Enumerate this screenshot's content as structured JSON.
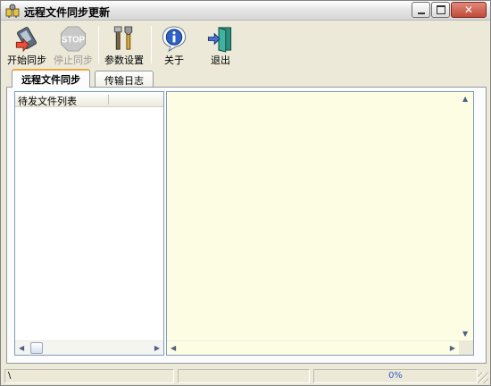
{
  "window": {
    "title": "远程文件同步更新"
  },
  "toolbar": {
    "buttons": [
      {
        "label": "开始同步",
        "icon": "sync-start-icon",
        "enabled": true
      },
      {
        "label": "停止同步",
        "icon": "stop-sign-icon",
        "enabled": false,
        "icon_text": "STOP"
      },
      {
        "label": "参数设置",
        "icon": "settings-tools-icon",
        "enabled": true
      },
      {
        "label": "关于",
        "icon": "info-icon",
        "enabled": true
      },
      {
        "label": "退出",
        "icon": "exit-door-icon",
        "enabled": true
      }
    ]
  },
  "tabs": [
    {
      "label": "远程文件同步",
      "active": true
    },
    {
      "label": "传输日志",
      "active": false
    }
  ],
  "file_list": {
    "header": "待发文件列表"
  },
  "statusbar": {
    "panel1": "\\",
    "panel2": "",
    "progress": "0%"
  }
}
